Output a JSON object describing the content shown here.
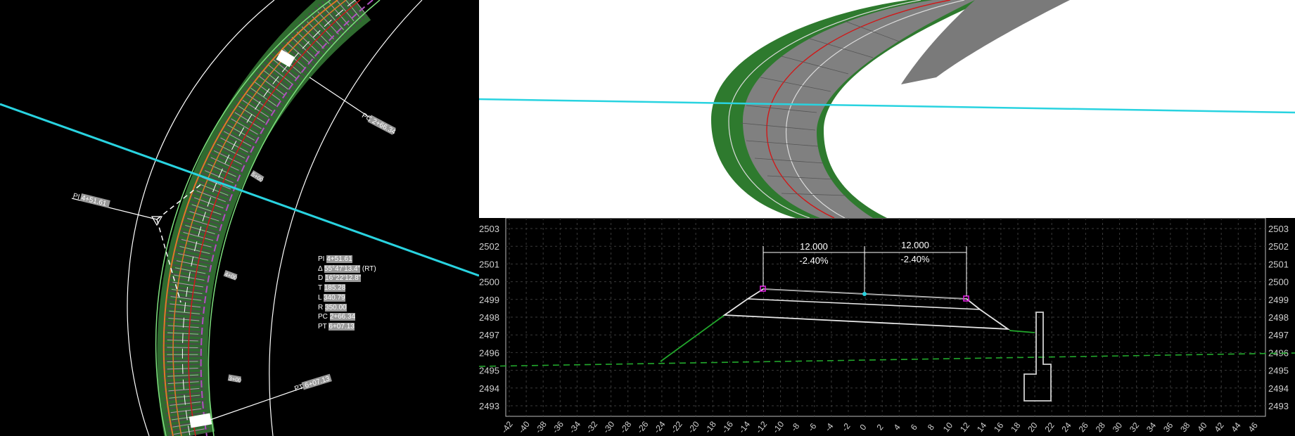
{
  "plan_view": {
    "pi_label": "PI 4+51.61",
    "pc_label": "PC 2+66.34",
    "pt_label": "PT 6+07.13",
    "station_ticks": [
      "5+00",
      "4+00",
      "3+00"
    ],
    "curve_data": [
      {
        "key": "PI",
        "value": "4+51.61",
        "suffix": ""
      },
      {
        "key": "Δ",
        "value": "55°47'13.4\"",
        "suffix": "(RT)"
      },
      {
        "key": "D",
        "value": "16°22'12.8\"",
        "suffix": ""
      },
      {
        "key": "T",
        "value": "185.28",
        "suffix": ""
      },
      {
        "key": "L",
        "value": "340.79",
        "suffix": ""
      },
      {
        "key": "R",
        "value": "350.00",
        "suffix": ""
      },
      {
        "key": "PC",
        "value": "2+66.34",
        "suffix": ""
      },
      {
        "key": "PT",
        "value": "6+07.13",
        "suffix": ""
      }
    ]
  },
  "cross_section": {
    "y_labels": [
      "2503",
      "2502",
      "2501",
      "2500",
      "2499",
      "2498",
      "2497",
      "2496",
      "2495",
      "2494",
      "2493"
    ],
    "x_labels": [
      "-42",
      "-40",
      "-38",
      "-36",
      "-34",
      "-32",
      "-30",
      "-28",
      "-26",
      "-24",
      "-22",
      "-20",
      "-18",
      "-16",
      "-14",
      "-12",
      "-10",
      "-8",
      "-6",
      "-4",
      "-2",
      "0",
      "2",
      "4",
      "6",
      "8",
      "10",
      "12",
      "14",
      "16",
      "18",
      "20",
      "22",
      "24",
      "26",
      "28",
      "30",
      "32",
      "34",
      "36",
      "38",
      "40",
      "42",
      "44",
      "46"
    ],
    "left_width": "12.000",
    "right_width": "12.000",
    "left_slope": "-2.40%",
    "right_slope": "-2.40%"
  },
  "colors": {
    "alignment_cyan": "#29d3e0",
    "ground_green": "#22a82c",
    "centerline_red": "#d01818",
    "plan_orange": "#e07828",
    "plan_purple": "#b050c0",
    "template_magenta": "#e020e0"
  }
}
